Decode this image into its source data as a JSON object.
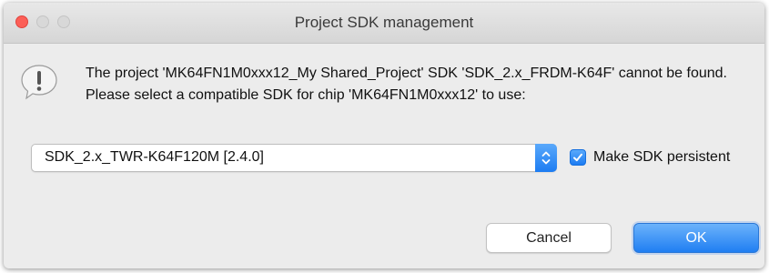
{
  "window": {
    "title": "Project SDK management"
  },
  "message": {
    "line1": "The project 'MK64FN1M0xxx12_My Shared_Project' SDK 'SDK_2.x_FRDM-K64F' cannot be found.",
    "line2": "Please select a compatible SDK for chip 'MK64FN1M0xxx12' to use:"
  },
  "sdk_select": {
    "selected": "SDK_2.x_TWR-K64F120M [2.4.0]"
  },
  "persist_checkbox": {
    "label": "Make SDK persistent",
    "checked": true
  },
  "buttons": {
    "cancel_label": "Cancel",
    "ok_label": "OK"
  },
  "icons": {
    "alert": "alert-icon",
    "dropdown": "chevron-updown-icon",
    "check": "checkmark-icon"
  },
  "colors": {
    "accent": "#1c7cf2",
    "close_button": "#fc5f57"
  }
}
